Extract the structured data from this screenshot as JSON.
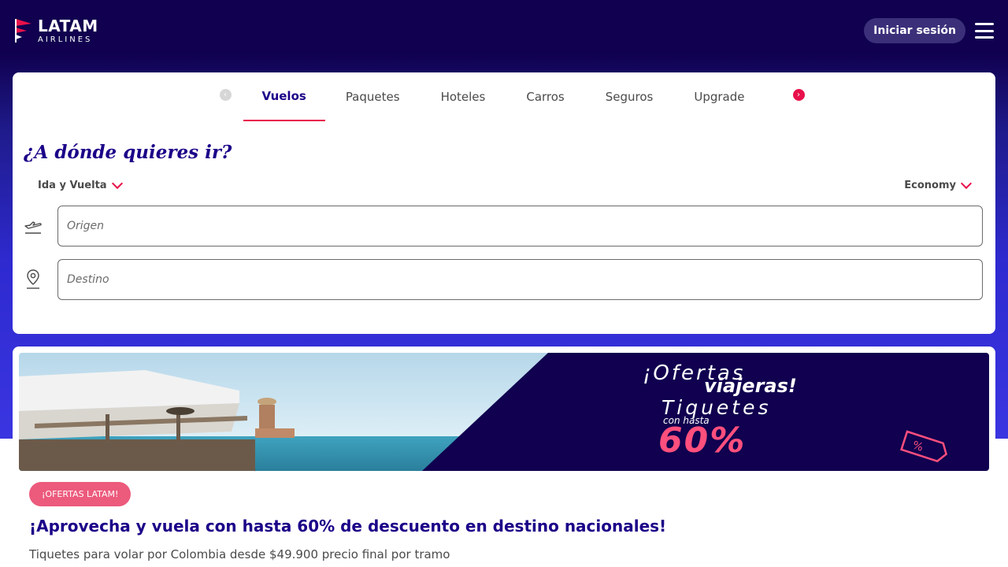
{
  "header": {
    "logo_main": "LATAM",
    "logo_sub": "AIRLINES",
    "login_label": "Iniciar sesión"
  },
  "tabs": [
    {
      "label": "Vuelos",
      "active": true
    },
    {
      "label": "Paquetes",
      "active": false
    },
    {
      "label": "Hoteles",
      "active": false
    },
    {
      "label": "Carros",
      "active": false
    },
    {
      "label": "Seguros",
      "active": false
    },
    {
      "label": "Upgrade",
      "active": false
    }
  ],
  "search": {
    "title": "¿A dónde quieres ir?",
    "trip_type": "Ida y Vuelta",
    "cabin": "Economy",
    "origin_placeholder": "Origen",
    "destination_placeholder": "Destino"
  },
  "banner": {
    "line1": "¡Ofertas",
    "line2": "viajeras!",
    "line3": "Tiquetes",
    "line4": "con hasta",
    "line5": "60%"
  },
  "offer": {
    "badge": "¡OFERTAS LATAM!",
    "title": "¡Aprovecha y vuela con hasta 60% de descuento en destino nacionales!",
    "subtitle": "Tiquetes para volar por Colombia desde $49.900 precio final por tramo"
  },
  "colors": {
    "brand_dark": "#10004f",
    "brand_blue": "#1b0088",
    "accent": "#e8114b",
    "badge": "#ec5a7c"
  }
}
